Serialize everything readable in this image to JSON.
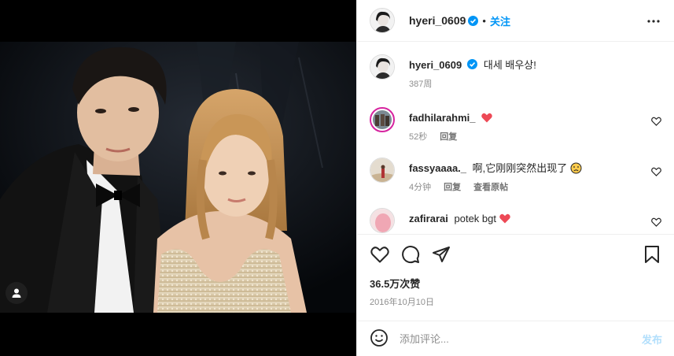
{
  "post": {
    "author": "hyeri_0609",
    "follow_label": "关注",
    "dot": "•",
    "caption_author": "hyeri_0609",
    "caption": "대세 배우상!",
    "caption_age": "387周",
    "likes": "36.5万次赞",
    "date": "2016年10月10日"
  },
  "comments": [
    {
      "user": "fadhilarahmi_",
      "text": "",
      "emoji": "heart",
      "age": "52秒",
      "reply": "回复",
      "view_translation": ""
    },
    {
      "user": "fassyaaaa._",
      "text": "啊,它刚刚突然出现了",
      "emoji": "sad",
      "age": "4分钟",
      "reply": "回复",
      "view_translation": "查看原帖"
    },
    {
      "user": "zafirarai",
      "text": "potek bgt",
      "emoji": "heart"
    }
  ],
  "compose": {
    "placeholder": "添加评论...",
    "post_label": "发布"
  },
  "icons": {
    "verified": "verified-badge-icon",
    "more": "more-horizontal-icon",
    "like": "heart-outline-icon",
    "comment": "comment-bubble-icon",
    "share": "paper-plane-icon",
    "save": "bookmark-icon",
    "emoji": "smiley-icon",
    "tag": "person-tag-icon"
  },
  "colors": {
    "verified": "#0095f6",
    "follow": "#0095f6",
    "heart": "#ed4956",
    "post_disabled": "#b2dffc"
  }
}
